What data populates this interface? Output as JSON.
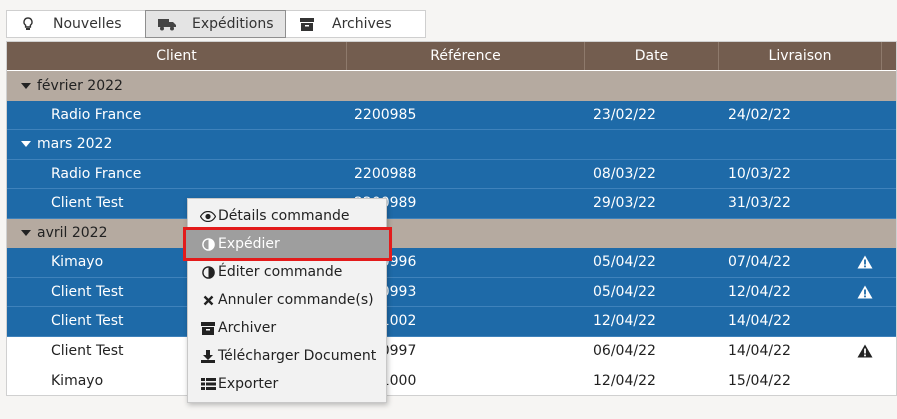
{
  "tabs": [
    {
      "label": "Nouvelles",
      "icon": "lightbulb-icon",
      "active": false
    },
    {
      "label": "Expéditions",
      "icon": "truck-icon",
      "active": true
    },
    {
      "label": "Archives",
      "icon": "archive-box-icon",
      "active": false
    }
  ],
  "grid": {
    "columns": [
      "Client",
      "Référence",
      "Date",
      "Livraison"
    ],
    "groups": [
      {
        "label": "février 2022"
      },
      {
        "label": "mars 2022"
      },
      {
        "label": "avril 2022"
      }
    ],
    "rows": [
      {
        "client": "Radio France",
        "ref": "2200985",
        "date": "23/02/22",
        "livraison": "24/02/22",
        "warning": false
      },
      {
        "client": "Radio France",
        "ref": "2200988",
        "date": "08/03/22",
        "livraison": "10/03/22",
        "warning": false
      },
      {
        "client": "Client Test",
        "ref": "2200989",
        "date": "29/03/22",
        "livraison": "31/03/22",
        "warning": false
      },
      {
        "client": "Kimayo",
        "ref": "2200996",
        "date": "05/04/22",
        "livraison": "07/04/22",
        "warning": true
      },
      {
        "client": "Client Test",
        "ref": "2200993",
        "date": "05/04/22",
        "livraison": "12/04/22",
        "warning": true
      },
      {
        "client": "Client Test",
        "ref": "2201002",
        "date": "12/04/22",
        "livraison": "14/04/22",
        "warning": false
      },
      {
        "client": "Client Test",
        "ref": "2200997",
        "date": "06/04/22",
        "livraison": "14/04/22",
        "warning": true
      },
      {
        "client": "Kimayo",
        "ref": "2201000",
        "date": "12/04/22",
        "livraison": "15/04/22",
        "warning": false
      }
    ]
  },
  "context_menu": {
    "items": [
      {
        "label": "Détails commande",
        "icon": "eye-icon"
      },
      {
        "label": "Expédier",
        "icon": "half-circle-icon",
        "highlighted": true
      },
      {
        "label": "Éditer commande",
        "icon": "half-circle-icon"
      },
      {
        "label": "Annuler commande(s)",
        "icon": "x-icon"
      },
      {
        "label": "Archiver",
        "icon": "archive-box-icon"
      },
      {
        "label": "Télécharger Document",
        "icon": "download-icon"
      },
      {
        "label": "Exporter",
        "icon": "list-icon"
      }
    ]
  },
  "colors": {
    "header": "#735d4f",
    "group_row": "#b5aaa0",
    "selected_row": "#1e6aa8",
    "highlight_outline": "#e31b1b"
  }
}
